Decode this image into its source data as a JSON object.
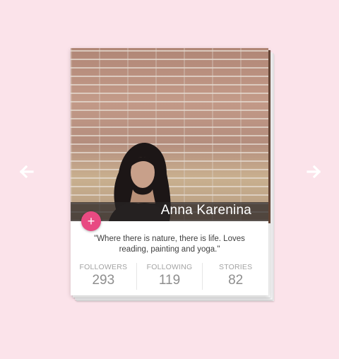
{
  "profile": {
    "name": "Anna Karenina",
    "bio": "\"Where there is nature, there is life. Loves reading, painting and yoga.\"",
    "add_label": "+"
  },
  "stats": [
    {
      "label": "FOLLOWERS",
      "value": "293"
    },
    {
      "label": "FOLLOWING",
      "value": "119"
    },
    {
      "label": "STORIES",
      "value": "82"
    }
  ],
  "colors": {
    "background": "#fbe3ea",
    "accent": "#e84a82",
    "card": "#ffffff"
  },
  "icons": {
    "prev": "arrow-left-icon",
    "next": "arrow-right-icon"
  }
}
